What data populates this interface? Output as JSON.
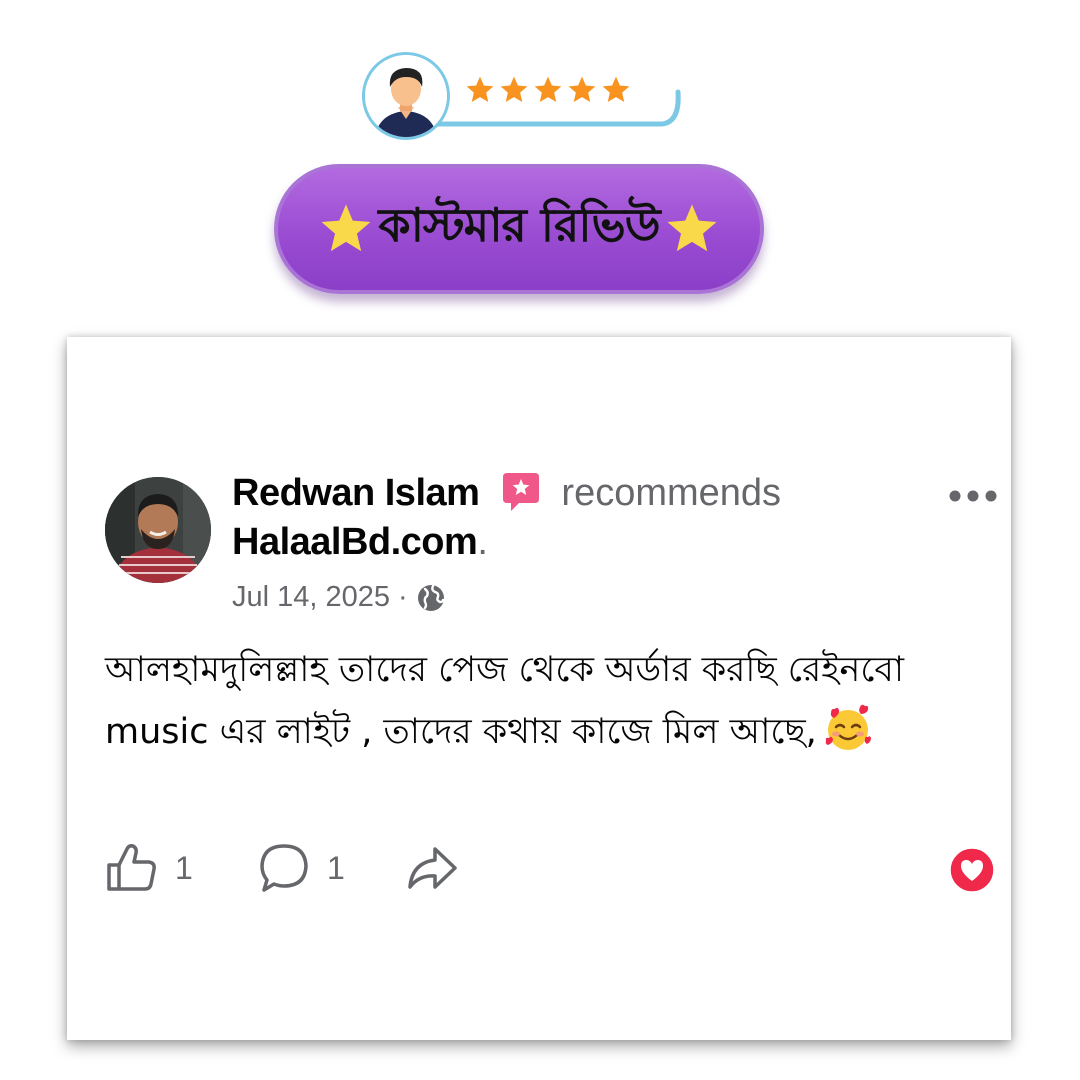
{
  "header": {
    "rating": {
      "stars": 5,
      "max": 5,
      "star_color": "#f7931e"
    },
    "title": "কাস্টমার রিভিউ",
    "title_star_color": "#f9d94a",
    "pill_color": "#a35ad9"
  },
  "review": {
    "reviewer_name": "Redwan Islam",
    "action_text": "recommends",
    "page_name": "HalaalBd.com",
    "page_suffix": ".",
    "date": "Jul 14, 2025",
    "meta_separator": "·",
    "audience_icon": "globe-icon",
    "text": "আলহামদুলিল্লাহ তাদের পেজ থেকে অর্ডার করছি রেইনবো music এর লাইট , তাদের কথায় কাজে মিল আছে,",
    "emoji": "smiling-face-with-hearts-icon",
    "reaction": "heart-reaction-icon",
    "reaction_color": "#f0284a",
    "likes": "1",
    "comments": "1"
  }
}
